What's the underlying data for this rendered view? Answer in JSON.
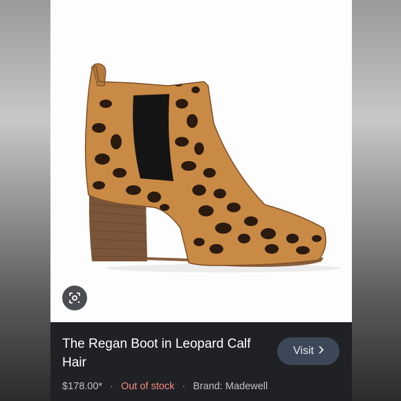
{
  "product": {
    "title": "The Regan Boot in Leopard Calf Hair",
    "price": "$178.00*",
    "stock_status": "Out of stock",
    "brand": "Brand: Madewell",
    "separator": "·"
  },
  "actions": {
    "visit_label": "Visit",
    "visit_icon": "chevron-right-icon",
    "lens_icon": "lens-search-icon"
  },
  "colors": {
    "info_background": "#202124",
    "visit_background": "#3c4858",
    "out_of_stock": "#f28b82"
  }
}
